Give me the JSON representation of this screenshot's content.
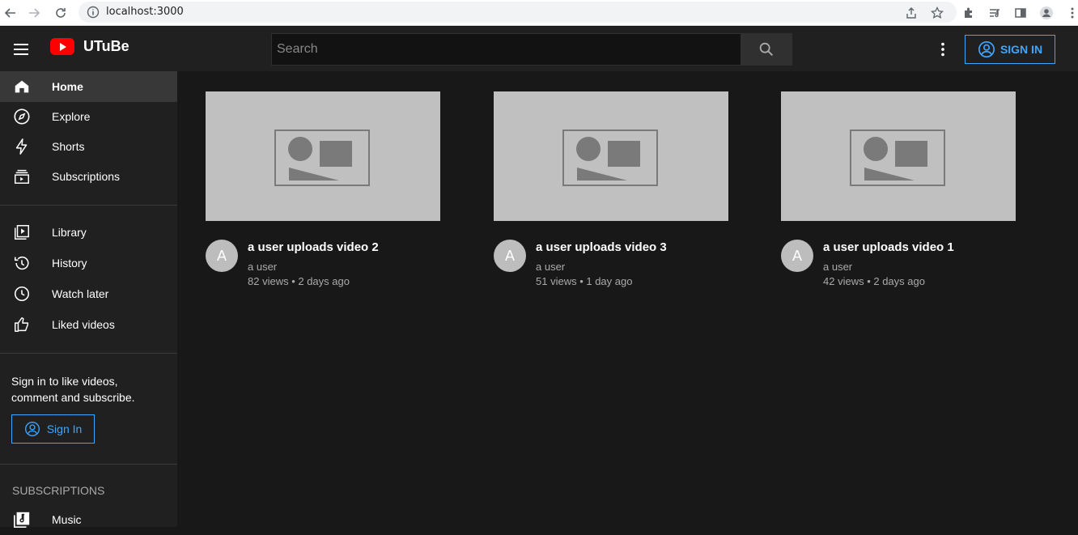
{
  "browser": {
    "url": "localhost:3000",
    "icons": [
      "back-icon",
      "forward-icon",
      "reload-icon",
      "info-icon",
      "share-icon",
      "star-icon",
      "extensions-icon",
      "reading-list-icon",
      "side-panel-icon",
      "profile-icon",
      "chrome-menu-icon"
    ]
  },
  "header": {
    "brand": "UTuBe",
    "search_placeholder": "Search",
    "signin_label": "SIGN IN"
  },
  "sidebar": {
    "items": [
      {
        "label": "Home",
        "icon": "home-icon"
      },
      {
        "label": "Explore",
        "icon": "compass-icon"
      },
      {
        "label": "Shorts",
        "icon": "bolt-icon"
      },
      {
        "label": "Subscriptions",
        "icon": "subscriptions-icon"
      },
      {
        "label": "Library",
        "icon": "library-icon"
      },
      {
        "label": "History",
        "icon": "history-icon"
      },
      {
        "label": "Watch later",
        "icon": "clock-icon"
      },
      {
        "label": "Liked videos",
        "icon": "thumb-up-icon"
      }
    ],
    "signin_prompt": "Sign in to like videos, comment and subscribe.",
    "signin_label": "Sign In",
    "subscriptions_heading": "SUBSCRIPTIONS",
    "subscriptions": [
      {
        "label": "Music",
        "icon": "music-icon"
      }
    ]
  },
  "videos": [
    {
      "title": "a user uploads video 2",
      "channel": "a user",
      "meta": "82 views • 2 days ago",
      "avatar_letter": "A"
    },
    {
      "title": "a user uploads video 3",
      "channel": "a user",
      "meta": "51 views • 1 day ago",
      "avatar_letter": "A"
    },
    {
      "title": "a user uploads video 1",
      "channel": "a user",
      "meta": "42 views • 2 days ago",
      "avatar_letter": "A"
    }
  ],
  "colors": {
    "accent": "#3ea6ff",
    "brand_red": "#ff0000",
    "background": "#181818",
    "surface": "#202020"
  }
}
